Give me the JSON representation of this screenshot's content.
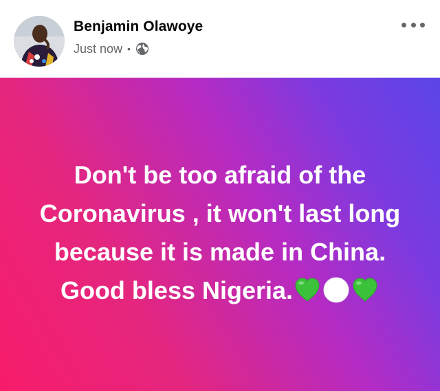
{
  "post": {
    "author": "Benjamin Olawoye",
    "timestamp": "Just now",
    "separator": "•",
    "privacy_icon": "globe-icon",
    "menu_icon": "more-horizontal-icon",
    "text": "Don't be too afraid of the Coronavirus , it won't last long because it is made in China. Good bless Nigeria.",
    "emojis": [
      "green-heart",
      "white-circle",
      "green-heart"
    ]
  },
  "colors": {
    "name": "#050505",
    "meta": "#65676b",
    "gradient_start": "#f81c6a",
    "gradient_mid": "#b42bc4",
    "gradient_end": "#5b45e8",
    "text": "#ffffff",
    "green_heart": "#3cc13b"
  }
}
